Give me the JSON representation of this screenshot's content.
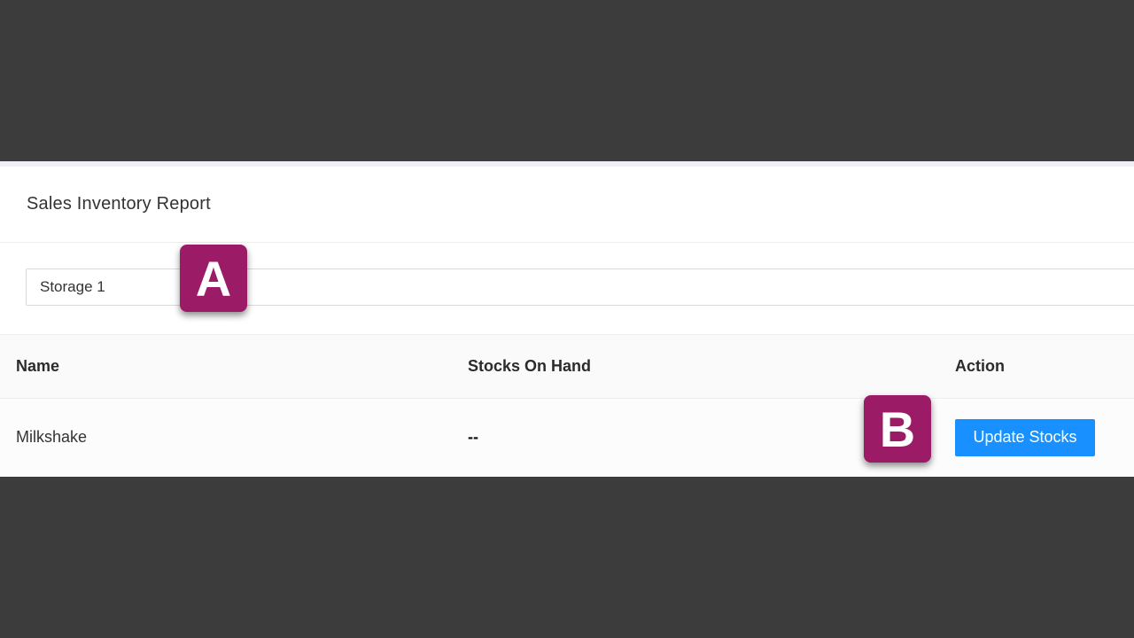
{
  "header": {
    "title": "Sales Inventory Report"
  },
  "filter": {
    "selected_storage": "Storage 1"
  },
  "table": {
    "columns": [
      "Name",
      "Stocks On Hand",
      "Action"
    ],
    "rows": [
      {
        "name": "Milkshake",
        "stocks_on_hand": "--",
        "action_label": "Update Stocks"
      }
    ]
  },
  "annotations": {
    "a": "A",
    "b": "B"
  },
  "colors": {
    "background": "#3c3c3c",
    "accent": "#1890ff",
    "badge": "#9b1b66"
  }
}
